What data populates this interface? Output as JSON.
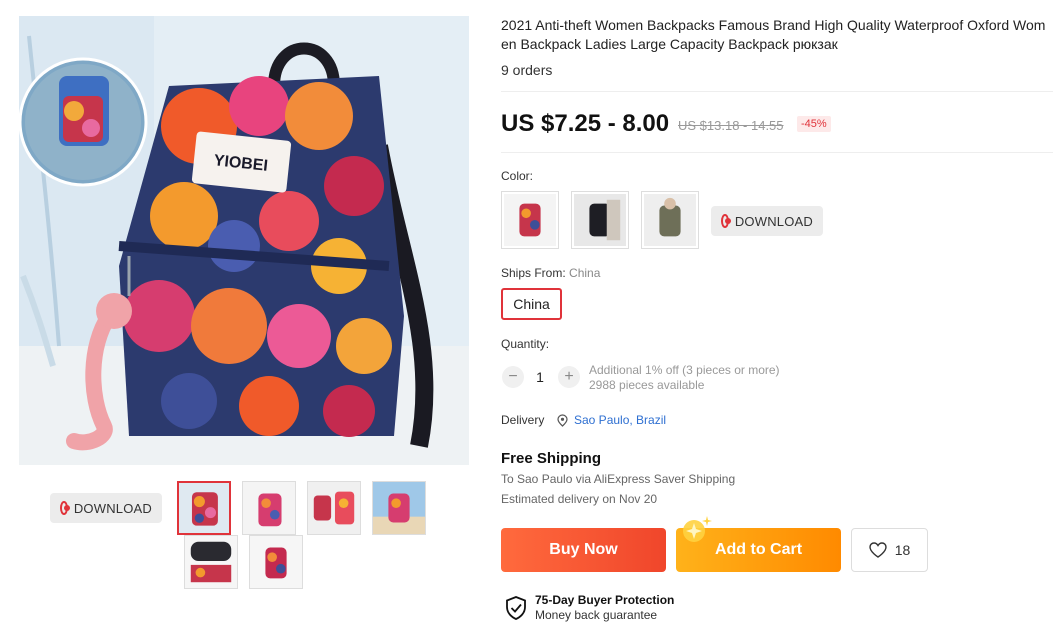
{
  "product": {
    "title": "2021 Anti-theft Women Backpacks Famous Brand High Quality Waterproof Oxford Women Backpack Ladies Large Capacity Backpack рюкзак",
    "orders": "9 orders",
    "price": "US $7.25 - 8.00",
    "original_price": "US $13.18 - 14.55",
    "discount": "-45%",
    "brand_tag": "YIOBEI"
  },
  "gallery": {
    "download_label": "DOWNLOAD",
    "thumbnails_count": 6
  },
  "options": {
    "color_label": "Color:",
    "color_download_label": "DOWNLOAD",
    "ships_from_label": "Ships From:",
    "ships_from_value": "China",
    "ships_from_selected": "China"
  },
  "quantity": {
    "label": "Quantity:",
    "minus": "−",
    "plus": "+",
    "value": "1",
    "additional": "Additional 1% off (3 pieces or more)",
    "available": "2988 pieces available"
  },
  "delivery": {
    "label": "Delivery",
    "location": "Sao Paulo, Brazil"
  },
  "shipping": {
    "title": "Free Shipping",
    "via": "To Sao Paulo via AliExpress Saver Shipping",
    "estimate": "Estimated delivery on Nov 20"
  },
  "actions": {
    "buy_now": "Buy Now",
    "add_to_cart": "Add to Cart",
    "wishlist_count": "18"
  },
  "protection": {
    "title": "75-Day Buyer Protection",
    "subtitle": "Money back guarantee"
  },
  "colors": {
    "accent": "#e0333a",
    "buy_now": "#f0462b",
    "add_to_cart": "#ff8a00",
    "link": "#2e6fd1"
  }
}
